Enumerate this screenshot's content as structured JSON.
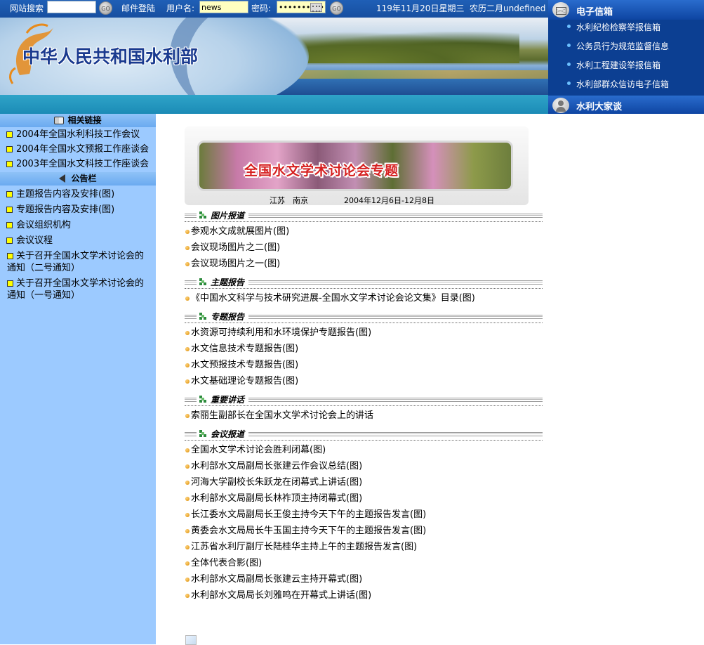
{
  "topbar": {
    "search_label": "网站搜索",
    "search_value": "",
    "go_label": "GO",
    "mail_login_label": "邮件登陆",
    "username_label": "用户名:",
    "username_value": "news",
    "password_label": "密码:",
    "password_value": "••••••••••",
    "date_text": "119年11月20日星期三",
    "lunar_text": "农历二月undefined"
  },
  "banner": {
    "site_title": "中华人民共和国水利部"
  },
  "right_panel": {
    "mailbox_title": "电子信箱",
    "mailbox_links": [
      "水利纪检检察举报信箱",
      "公务员行为规范监督信息",
      "水利工程建设举报信箱",
      "水利部群众信访电子信箱"
    ],
    "forum_title": "水利大家谈"
  },
  "sidebar": {
    "related_links_title": "相关链接",
    "related_links": [
      "2004年全国水利科技工作会议",
      "2004年全国水文预报工作座谈会",
      "2003年全国水文科技工作座谈会"
    ],
    "bulletin_title": "公告栏",
    "bulletin_items": [
      "主题报告内容及安排(图)",
      "专题报告内容及安排(图)",
      "会议组织机构",
      "会议议程",
      "关于召开全国水文学术讨论会的通知（二号通知）",
      "关于召开全国水文学术讨论会的通知（一号通知）"
    ]
  },
  "feature": {
    "title": "全国水文学术讨论会专题",
    "location": "江苏　南京",
    "dates": "2004年12月6日-12月8日"
  },
  "sections": [
    {
      "title": "图片报道",
      "items": [
        "参观水文成就展图片(图)",
        "会议现场图片之二(图)",
        "会议现场图片之一(图)"
      ]
    },
    {
      "title": "主题报告",
      "items": [
        "《中国水文科学与技术研究进展-全国水文学术讨论会论文集》目录(图)"
      ]
    },
    {
      "title": "专题报告",
      "items": [
        "水资源可持续利用和水环境保护专题报告(图)",
        "水文信息技术专题报告(图)",
        "水文预报技术专题报告(图)",
        "水文基础理论专题报告(图)"
      ]
    },
    {
      "title": "重要讲话",
      "items": [
        "索丽生副部长在全国水文学术讨论会上的讲话"
      ]
    },
    {
      "title": "会议报道",
      "items": [
        "全国水文学术讨论会胜利闭幕(图)",
        "水利部水文局副局长张建云作会议总结(图)",
        "河海大学副校长朱跃龙在闭幕式上讲话(图)",
        "水利部水文局副局长林祚顶主持闭幕式(图)",
        "长江委水文局副局长王俊主持今天下午的主题报告发言(图)",
        "黄委会水文局局长牛玉国主持今天下午的主题报告发言(图)",
        "江苏省水利厅副厅长陆桂华主持上午的主题报告发言(图)",
        "全体代表合影(图)",
        "水利部水文局副局长张建云主持开幕式(图)",
        "水利部水文局局长刘雅鸣在开幕式上讲话(图)"
      ]
    }
  ],
  "colors": {
    "sidebar_bg": "#9ccaff",
    "topbar_bg": "#1f5fb6",
    "right_panel_bg": "#0c3f92",
    "bullet": "#ffff00",
    "feature_title": "#d62020"
  }
}
